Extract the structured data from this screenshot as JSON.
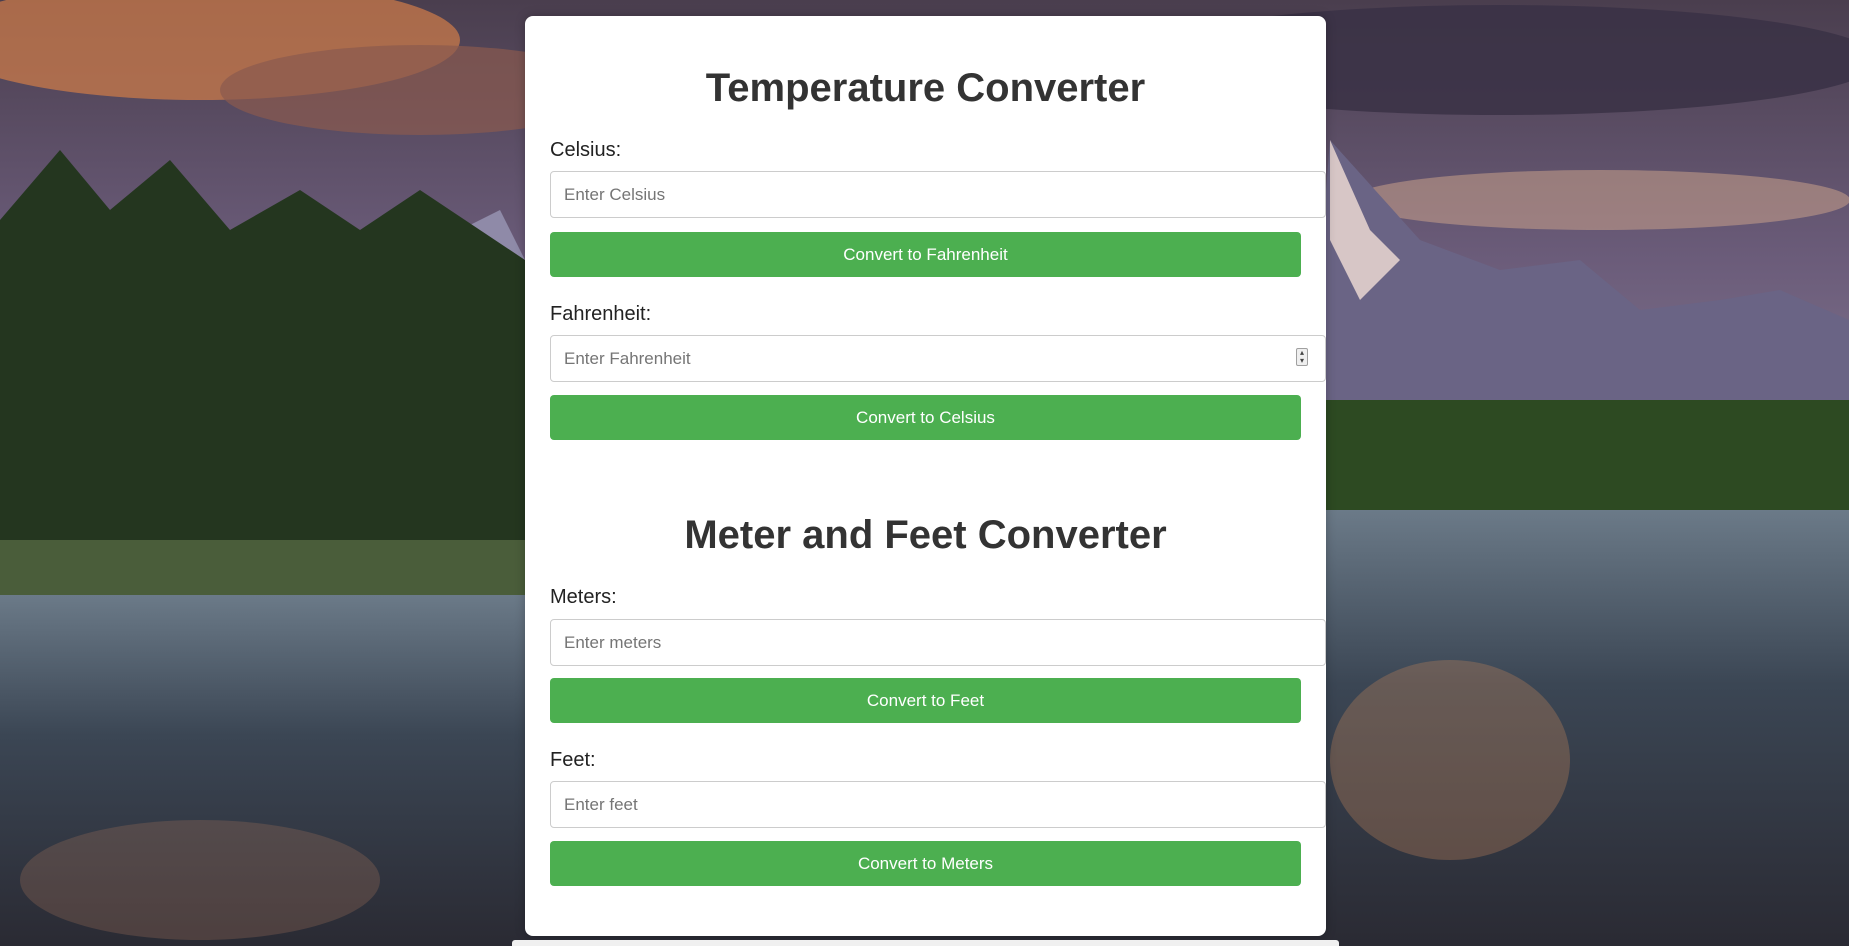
{
  "temperature": {
    "title": "Temperature Converter",
    "celsius_label": "Celsius:",
    "celsius_placeholder": "Enter Celsius",
    "to_fahrenheit_button": "Convert to Fahrenheit",
    "fahrenheit_label": "Fahrenheit:",
    "fahrenheit_placeholder": "Enter Fahrenheit",
    "to_celsius_button": "Convert to Celsius"
  },
  "length": {
    "title": "Meter and Feet Converter",
    "meters_label": "Meters:",
    "meters_placeholder": "Enter meters",
    "to_feet_button": "Convert to Feet",
    "feet_label": "Feet:",
    "feet_placeholder": "Enter feet",
    "to_meters_button": "Convert to Meters"
  },
  "colors": {
    "button_green": "#4caf50",
    "card_background": "#ffffff",
    "heading_text": "#333333"
  },
  "icons": {
    "number_spinner": "spinner-arrows-icon"
  }
}
